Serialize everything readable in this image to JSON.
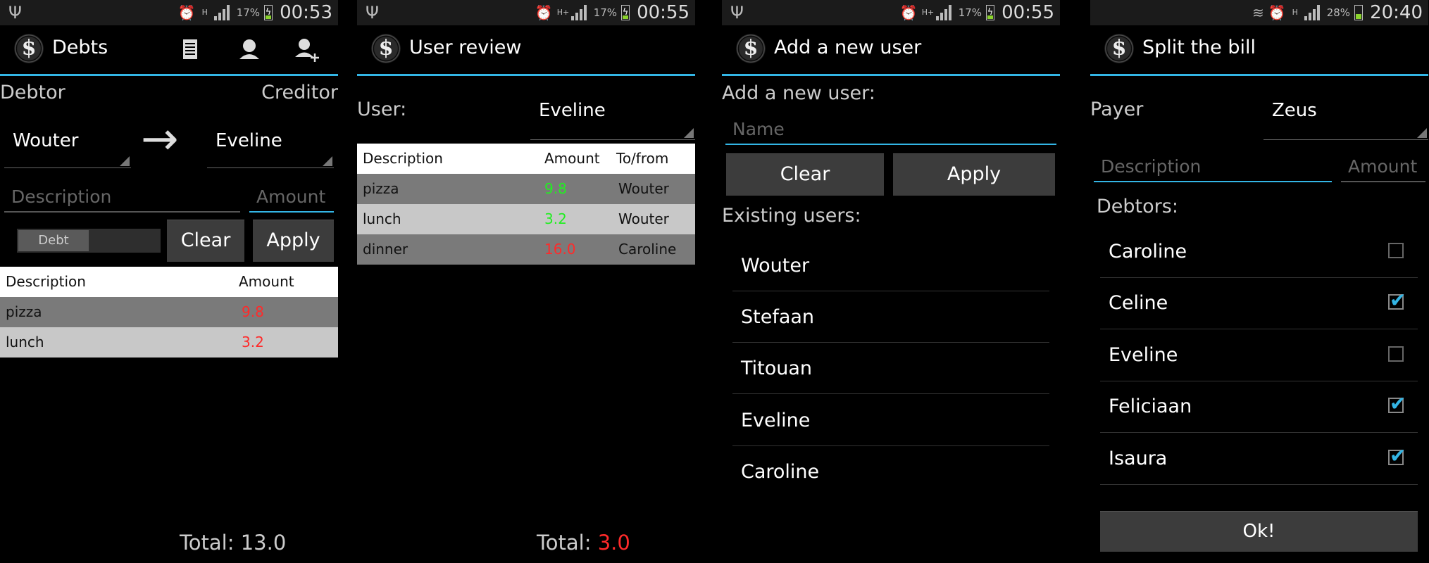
{
  "colors": {
    "accent": "#33b5e5",
    "negative": "#ff2a2a",
    "positive": "#22ee22",
    "background": "#000000"
  },
  "screens": [
    {
      "status": {
        "battery": "17%",
        "time": "00:53",
        "network": "H"
      },
      "title": "Debts",
      "actions": [
        "list-icon",
        "user-icon",
        "add-user-icon"
      ],
      "debtor_label": "Debtor",
      "creditor_label": "Creditor",
      "debtor_value": "Wouter",
      "creditor_value": "Eveline",
      "arrow": "→",
      "description_placeholder": "Description",
      "amount_placeholder": "Amount",
      "toggle_label": "Debt",
      "clear_label": "Clear",
      "apply_label": "Apply",
      "table": {
        "headers": [
          "Description",
          "Amount"
        ],
        "rows": [
          {
            "desc": "pizza",
            "amount": "9.8"
          },
          {
            "desc": "lunch",
            "amount": "3.2"
          }
        ]
      },
      "total_label": "Total: ",
      "total_value": "13.0"
    },
    {
      "status": {
        "battery": "17%",
        "time": "00:55",
        "network": "H+"
      },
      "title": "User review",
      "user_label": "User:",
      "user_value": "Eveline",
      "table": {
        "headers": [
          "Description",
          "Amount",
          "To/from"
        ],
        "rows": [
          {
            "desc": "pizza",
            "amount": "9.8",
            "who": "Wouter"
          },
          {
            "desc": "lunch",
            "amount": "3.2",
            "who": "Wouter"
          },
          {
            "desc": "dinner",
            "amount": "16.0",
            "who": "Caroline"
          }
        ]
      },
      "total_label": "Total: ",
      "total_value": "3.0"
    },
    {
      "status": {
        "battery": "17%",
        "time": "00:55",
        "network": "H+"
      },
      "title": "Add a new user",
      "add_label": "Add a new user:",
      "name_placeholder": "Name",
      "clear_label": "Clear",
      "apply_label": "Apply",
      "existing_label": "Existing users:",
      "users": [
        "Wouter",
        "Stefaan",
        "Titouan",
        "Eveline",
        "Caroline"
      ]
    },
    {
      "status": {
        "battery": "28%",
        "time": "20:40",
        "network": "H"
      },
      "title": "Split the bill",
      "payer_label": "Payer",
      "payer_value": "Zeus",
      "description_placeholder": "Description",
      "amount_placeholder": "Amount",
      "debtors_label": "Debtors:",
      "debtors": [
        {
          "name": "Caroline",
          "checked": false
        },
        {
          "name": "Celine",
          "checked": true
        },
        {
          "name": "Eveline",
          "checked": false
        },
        {
          "name": "Feliciaan",
          "checked": true
        },
        {
          "name": "Isaura",
          "checked": true
        }
      ],
      "ok_label": "Ok!"
    }
  ]
}
